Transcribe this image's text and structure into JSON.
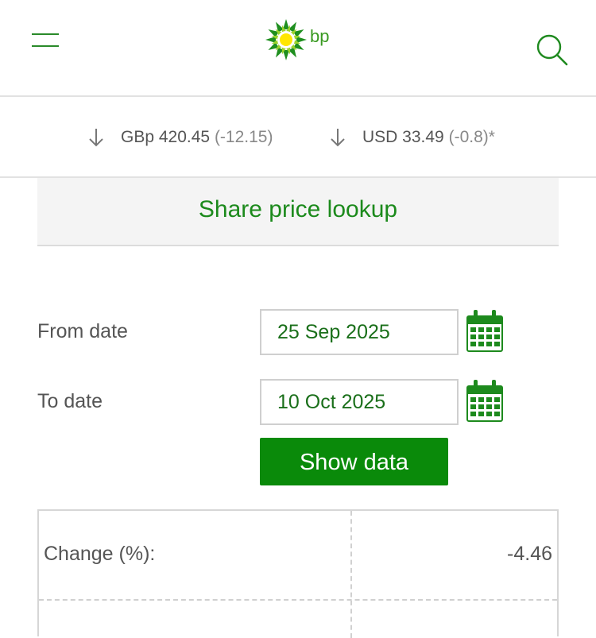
{
  "header": {
    "brand": "bp",
    "colors": {
      "brand_green": "#0a8a0a",
      "brand_yellow": "#ffe600"
    }
  },
  "ticker": {
    "gbp": {
      "price": "GBp 420.45",
      "change": "(-12.15)"
    },
    "usd": {
      "price": "USD 33.49",
      "change": "(-0.8)*"
    }
  },
  "panel": {
    "title": "Share price lookup"
  },
  "form": {
    "from_label": "From date",
    "from_value": "25 Sep 2025",
    "to_label": "To date",
    "to_value": "10 Oct 2025",
    "submit_label": "Show data"
  },
  "results": {
    "rows": [
      {
        "label": "Change (%):",
        "value": "-4.46"
      }
    ]
  }
}
